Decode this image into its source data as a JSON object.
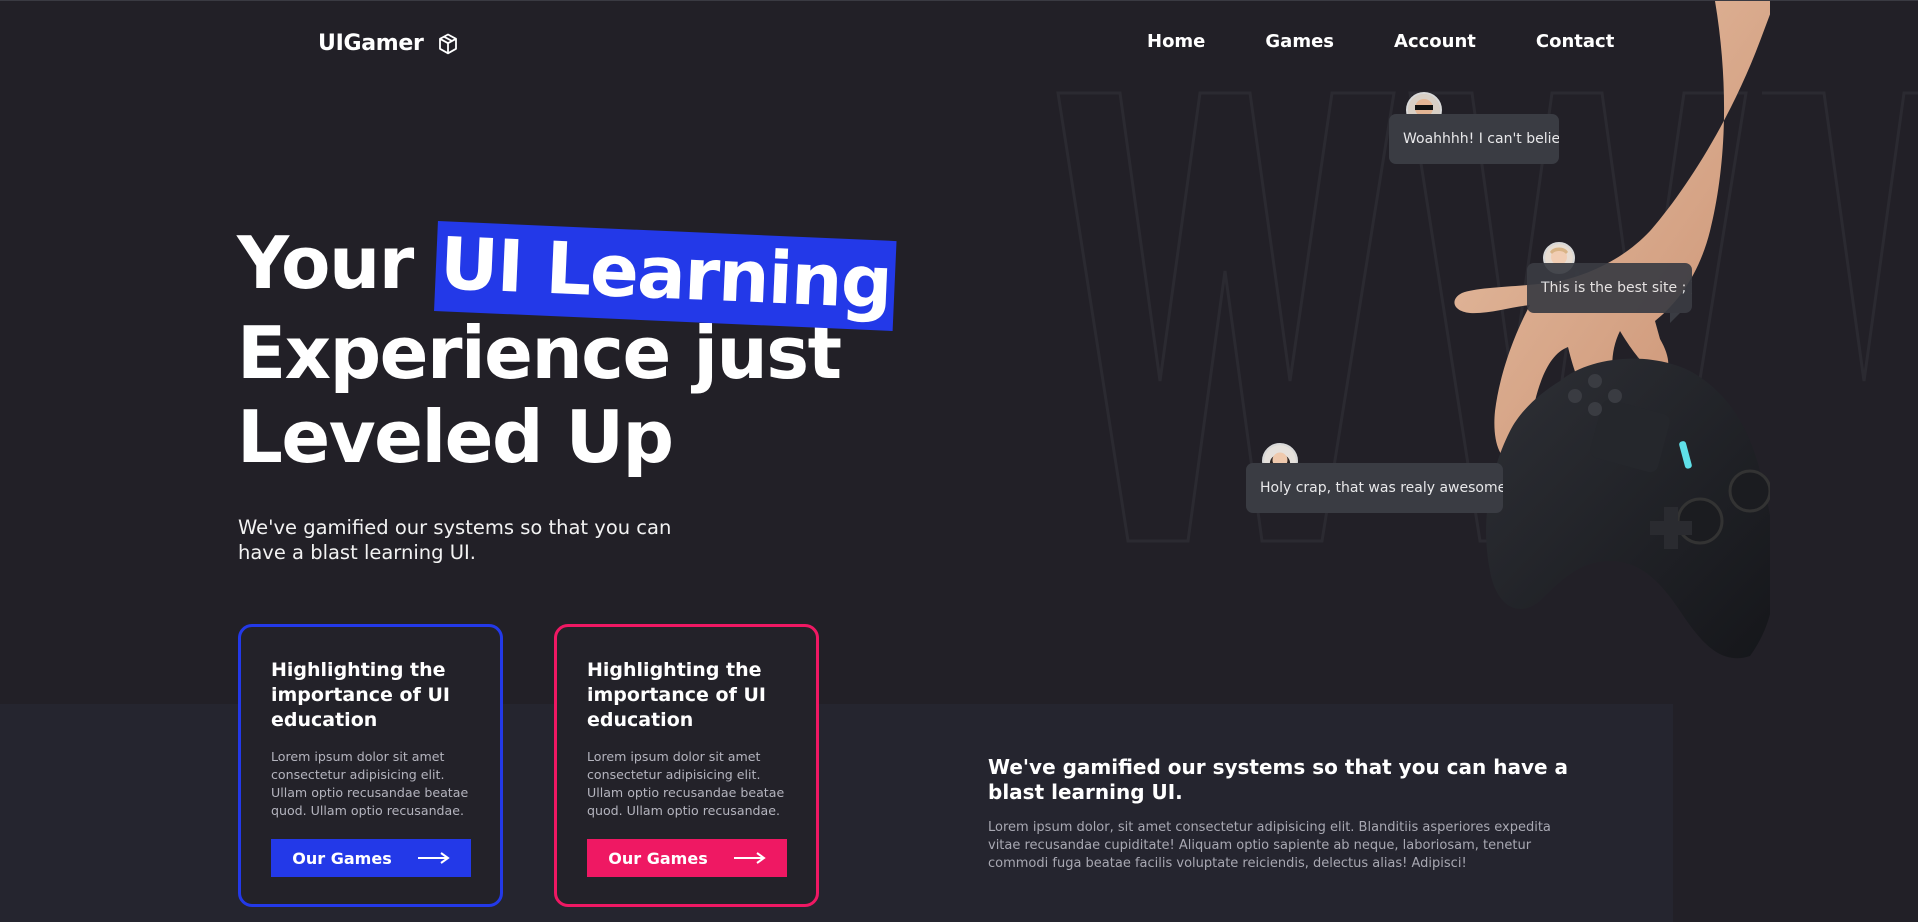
{
  "header": {
    "logo_text": "UIGamer",
    "logo_icon": "cube-icon",
    "nav": [
      {
        "label": "Home"
      },
      {
        "label": "Games"
      },
      {
        "label": "Account"
      },
      {
        "label": "Contact"
      }
    ]
  },
  "hero": {
    "title_part1": "Your",
    "title_highlight": "UI Learning",
    "title_line2": "Experience just",
    "title_line3": "Leveled Up",
    "subtitle": "We've gamified our systems so that you can have a blast learning UI."
  },
  "chat": [
    {
      "text": "Woahhhh! I can't belie"
    },
    {
      "text": "This is the best site ; )"
    },
    {
      "text": "Holy crap, that was realy awesome!"
    }
  ],
  "cards": [
    {
      "title": "Highlighting the importance of UI education",
      "text": "Lorem ipsum dolor sit amet consectetur adipisicing elit. Ullam optio recusandae beatae quod. Ullam optio recusandae.",
      "button": "Our Games"
    },
    {
      "title": "Highlighting the importance of UI education",
      "text": "Lorem ipsum dolor sit amet consectetur adipisicing elit. Ullam optio recusandae beatae quod. Ullam optio recusandae.",
      "button": "Our Games"
    }
  ],
  "band": {
    "title": "We've gamified our systems so that you can have a blast learning UI.",
    "text": "Lorem ipsum dolor, sit amet consectetur adipisicing elit. Blanditiis asperiores expedita vitae recusandae cupiditate! Aliquam optio sapiente ab neque, laboriosam, tenetur commodi fuga beatae facilis voluptate reiciendis, delectus alias! Adipisci!"
  },
  "colors": {
    "background": "#222027",
    "accent_blue": "#2339e8",
    "accent_pink": "#ef1863",
    "band": "#25252f"
  }
}
